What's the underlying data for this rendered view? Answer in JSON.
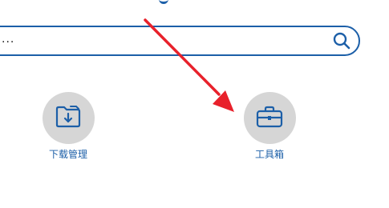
{
  "search": {
    "value": "..."
  },
  "tiles": [
    {
      "label": "下载管理",
      "icon": "folder-download-icon"
    },
    {
      "label": "工具箱",
      "icon": "toolbox-icon"
    }
  ],
  "colors": {
    "accent": "#1c5fa8",
    "tile_bg": "#d6d6d6",
    "arrow": "#e8212b"
  }
}
